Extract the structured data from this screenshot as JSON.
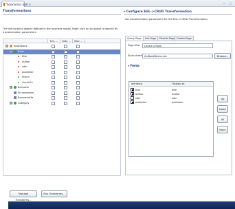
{
  "editor_tab": {
    "label": "*bookkeans.tpm",
    "close": "✕"
  },
  "window_controls": "▭ ▢",
  "left": {
    "title": "Transformations",
    "description": "The list contains objects defined in the business model. Right click on an object to specify its transformation parameters",
    "columns": [
      "EGL ...",
      "Data ...",
      "Web ..."
    ],
    "tree": [
      {
        "label": "booklieans",
        "level": 0,
        "expander": "⊟",
        "icon": "pkg",
        "checks": [
          false,
          false,
          false
        ]
      },
      {
        "label": "Book",
        "level": 1,
        "expander": "⊟",
        "icon": "cls",
        "checks": [
          true,
          true,
          true
        ],
        "selected": true
      },
      {
        "label": "title",
        "level": 2,
        "icon": "attr",
        "checks": [
          false,
          false,
          false
        ]
      },
      {
        "label": "author",
        "level": 2,
        "icon": "attr",
        "checks": [
          false,
          false,
          false
        ]
      },
      {
        "label": "isbn",
        "level": 2,
        "icon": "attr",
        "checks": [
          false,
          false,
          false
        ]
      },
      {
        "label": "publisher",
        "level": 2,
        "icon": "attr",
        "checks": [
          false,
          false,
          false
        ]
      },
      {
        "label": "return",
        "level": 2,
        "icon": "green",
        "checks": [
          false,
          false,
          false
        ]
      },
      {
        "label": "checkOu",
        "level": 2,
        "icon": "green",
        "checks": [
          false,
          false,
          false
        ]
      },
      {
        "label": "Borrower",
        "level": 1,
        "expander": "⊞",
        "icon": "cls",
        "checks": [
          false,
          false,
          false
        ]
      },
      {
        "label": "Enumeration",
        "level": 1,
        "icon": "enum",
        "checks": [
          false,
          false,
          false
        ]
      },
      {
        "label": "BorrowerSta",
        "level": 1,
        "icon": "enum",
        "checks": [
          false,
          false,
          false
        ]
      },
      {
        "label": "Category",
        "level": 1,
        "expander": "⊞",
        "icon": "cls",
        "checks": [
          false,
          false,
          false
        ]
      }
    ]
  },
  "right": {
    "title": "Configure EGL->CRUD Transformation",
    "description": "Set transformation parameters for the EGL->CRUD Transformation.",
    "tabs": [
      "Query Page",
      "List Page",
      "Details Page",
      "Create Page"
    ],
    "active_tab": 0,
    "page_title_label": "Page title:",
    "page_title_value": "Locate a Book",
    "style_sheet_label": "Style sheet:",
    "style_sheet_value": "/bnBookBeans.css",
    "browse": "Browse...",
    "fields_label": "Fields",
    "fields_columns": [
      "Attribute",
      "Display as"
    ],
    "fields": [
      {
        "attribute": "title",
        "display": "title",
        "checked": true
      },
      {
        "attribute": "author",
        "display": "author",
        "checked": true
      },
      {
        "attribute": "isbn",
        "display": "isbn",
        "checked": false
      },
      {
        "attribute": "publisher",
        "display": "publisher",
        "checked": true
      }
    ],
    "side_buttons": [
      "Up",
      "Down",
      "All",
      "None"
    ]
  },
  "bottom": {
    "manage_transforms": "Manage Transforms...",
    "run_transforms": "Run Transforms..."
  },
  "colors": {
    "accent": "#1d3b72",
    "selection": "#6a86c4",
    "status_bar": "#15306a"
  }
}
